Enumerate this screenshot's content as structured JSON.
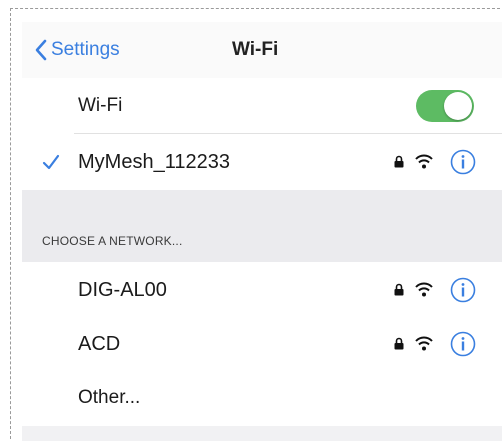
{
  "navbar": {
    "back_label": "Settings",
    "title": "Wi-Fi"
  },
  "wifi_toggle": {
    "label": "Wi-Fi",
    "state": "on",
    "color": "#5dbb63"
  },
  "connected": {
    "name": "MyMesh_112233",
    "secured": true
  },
  "section_header": "CHOOSE A NETWORK...",
  "networks": [
    {
      "name": "DIG-AL00",
      "secured": true
    },
    {
      "name": "ACD",
      "secured": true
    }
  ],
  "other_label": "Other...",
  "colors": {
    "accent": "#3a7fe0",
    "toggle_on": "#5dbb63",
    "group_background": "#ebebee"
  },
  "icons": [
    "chevron-left-icon",
    "checkmark-icon",
    "lock-icon",
    "wifi-icon",
    "info-icon"
  ]
}
